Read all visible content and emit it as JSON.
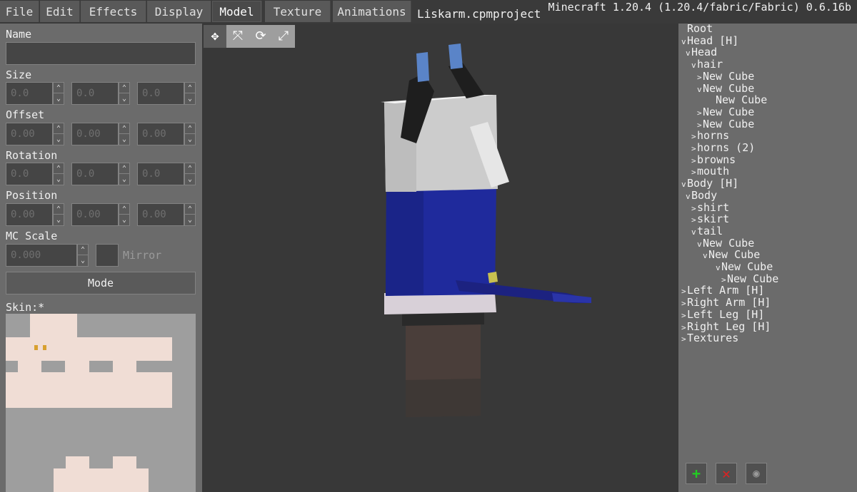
{
  "menu": {
    "tabs": [
      {
        "label": "File"
      },
      {
        "label": "Edit"
      },
      {
        "label": "Effects"
      },
      {
        "label": "Display"
      },
      {
        "label": "Model"
      },
      {
        "label": "Texture"
      },
      {
        "label": "Animations"
      }
    ],
    "project_name": "Liskarm.cpmproject",
    "version": "Minecraft 1.20.4 (1.20.4/fabric/Fabric) 0.6.16b"
  },
  "left_panel": {
    "name_label": "Name",
    "name_value": "",
    "size_label": "Size",
    "size_values": [
      "0.0",
      "0.0",
      "0.0"
    ],
    "offset_label": "Offset",
    "offset_values": [
      "0.00",
      "0.00",
      "0.00"
    ],
    "rotation_label": "Rotation",
    "rotation_values": [
      "0.0",
      "0.0",
      "0.0"
    ],
    "position_label": "Position",
    "position_values": [
      "0.00",
      "0.00",
      "0.00"
    ],
    "mc_scale_label": "MC Scale",
    "mc_scale_value": "0.000",
    "mirror_label": "Mirror",
    "mode_button": "Mode",
    "skin_label": "Skin:*"
  },
  "toolbar": {
    "tools": [
      "move-icon",
      "resize-icon",
      "rotate-icon",
      "scale-icon"
    ]
  },
  "tree": {
    "items": [
      {
        "label": "Root",
        "chev": ""
      },
      {
        "label": "Head [H]",
        "chev": "v"
      },
      {
        "label": "Head",
        "chev": "v"
      },
      {
        "label": "hair",
        "chev": "v"
      },
      {
        "label": "New Cube",
        "chev": ">"
      },
      {
        "label": "New Cube",
        "chev": "v"
      },
      {
        "label": "New Cube",
        "chev": ""
      },
      {
        "label": "New Cube",
        "chev": ">"
      },
      {
        "label": "New Cube",
        "chev": ">"
      },
      {
        "label": "horns",
        "chev": ">"
      },
      {
        "label": "horns (2)",
        "chev": ">"
      },
      {
        "label": "browns",
        "chev": ">"
      },
      {
        "label": "mouth",
        "chev": ">"
      },
      {
        "label": "Body [H]",
        "chev": "v"
      },
      {
        "label": "Body",
        "chev": "v"
      },
      {
        "label": "shirt",
        "chev": ">"
      },
      {
        "label": "skirt",
        "chev": ">"
      },
      {
        "label": "tail",
        "chev": "v"
      },
      {
        "label": "New Cube",
        "chev": "v"
      },
      {
        "label": "New Cube",
        "chev": "v"
      },
      {
        "label": "New Cube",
        "chev": "v"
      },
      {
        "label": "New Cube",
        "chev": ">"
      },
      {
        "label": "Left Arm [H]",
        "chev": ">"
      },
      {
        "label": "Right Arm [H]",
        "chev": ">"
      },
      {
        "label": "Left Leg [H]",
        "chev": ">"
      },
      {
        "label": "Right Leg [H]",
        "chev": ">"
      },
      {
        "label": "Textures",
        "chev": ">"
      }
    ],
    "actions": [
      "add-icon",
      "delete-icon",
      "visibility-icon"
    ]
  },
  "colors": {
    "add": "#22cc22",
    "delete": "#dd2222",
    "skin": "#f0ddd5"
  }
}
